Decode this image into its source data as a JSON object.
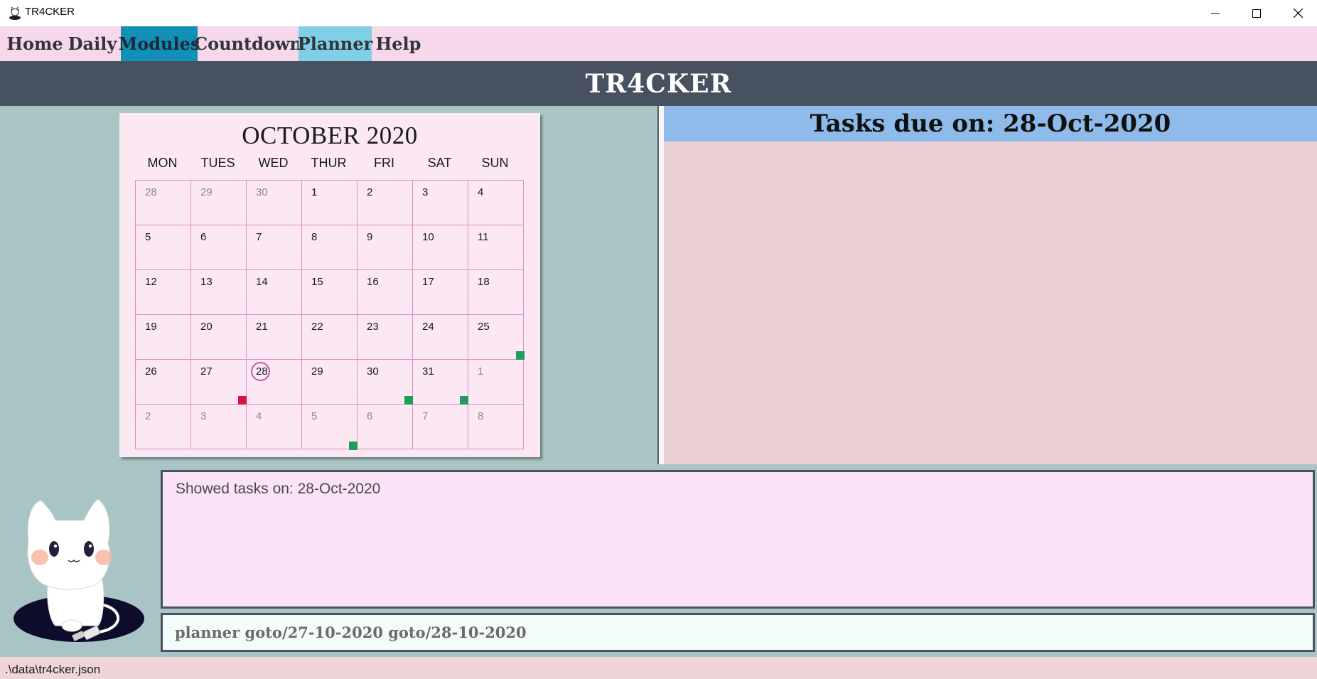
{
  "window": {
    "title": "TR4CKER"
  },
  "menu": {
    "items": [
      {
        "label": "Home"
      },
      {
        "label": "Daily"
      },
      {
        "label": "Modules"
      },
      {
        "label": "Countdown"
      },
      {
        "label": "Planner"
      },
      {
        "label": "Help"
      }
    ],
    "active": "Planner",
    "highlighted": "Modules"
  },
  "header": {
    "title": "TR4CKER"
  },
  "calendar": {
    "title": "OCTOBER 2020",
    "weekdays": [
      "MON",
      "TUES",
      "WED",
      "THUR",
      "FRI",
      "SAT",
      "SUN"
    ],
    "weeks": [
      [
        {
          "d": "28",
          "muted": true
        },
        {
          "d": "29",
          "muted": true
        },
        {
          "d": "30",
          "muted": true
        },
        {
          "d": "1"
        },
        {
          "d": "2"
        },
        {
          "d": "3"
        },
        {
          "d": "4"
        }
      ],
      [
        {
          "d": "5"
        },
        {
          "d": "6"
        },
        {
          "d": "7"
        },
        {
          "d": "8"
        },
        {
          "d": "9"
        },
        {
          "d": "10"
        },
        {
          "d": "11"
        }
      ],
      [
        {
          "d": "12"
        },
        {
          "d": "13"
        },
        {
          "d": "14"
        },
        {
          "d": "15"
        },
        {
          "d": "16"
        },
        {
          "d": "17"
        },
        {
          "d": "18"
        }
      ],
      [
        {
          "d": "19"
        },
        {
          "d": "20"
        },
        {
          "d": "21"
        },
        {
          "d": "22"
        },
        {
          "d": "23"
        },
        {
          "d": "24"
        },
        {
          "d": "25",
          "marker": "green"
        }
      ],
      [
        {
          "d": "26"
        },
        {
          "d": "27",
          "marker": "red"
        },
        {
          "d": "28",
          "today": true
        },
        {
          "d": "29"
        },
        {
          "d": "30",
          "marker": "green"
        },
        {
          "d": "31",
          "marker": "green"
        },
        {
          "d": "1",
          "muted": true
        }
      ],
      [
        {
          "d": "2",
          "muted": true
        },
        {
          "d": "3",
          "muted": true
        },
        {
          "d": "4",
          "muted": true
        },
        {
          "d": "5",
          "muted": true,
          "marker": "green"
        },
        {
          "d": "6",
          "muted": true
        },
        {
          "d": "7",
          "muted": true
        },
        {
          "d": "8",
          "muted": true
        }
      ]
    ],
    "marker_colors": {
      "green": "#1f9d5c",
      "red": "#dd1040"
    }
  },
  "tasks": {
    "title": "Tasks due on: 28-Oct-2020"
  },
  "result": {
    "text": "Showed tasks on: 28-Oct-2020"
  },
  "command": {
    "value": "planner goto/27-10-2020 goto/28-10-2020"
  },
  "status": {
    "path": ".\\data\\tr4cker.json"
  }
}
